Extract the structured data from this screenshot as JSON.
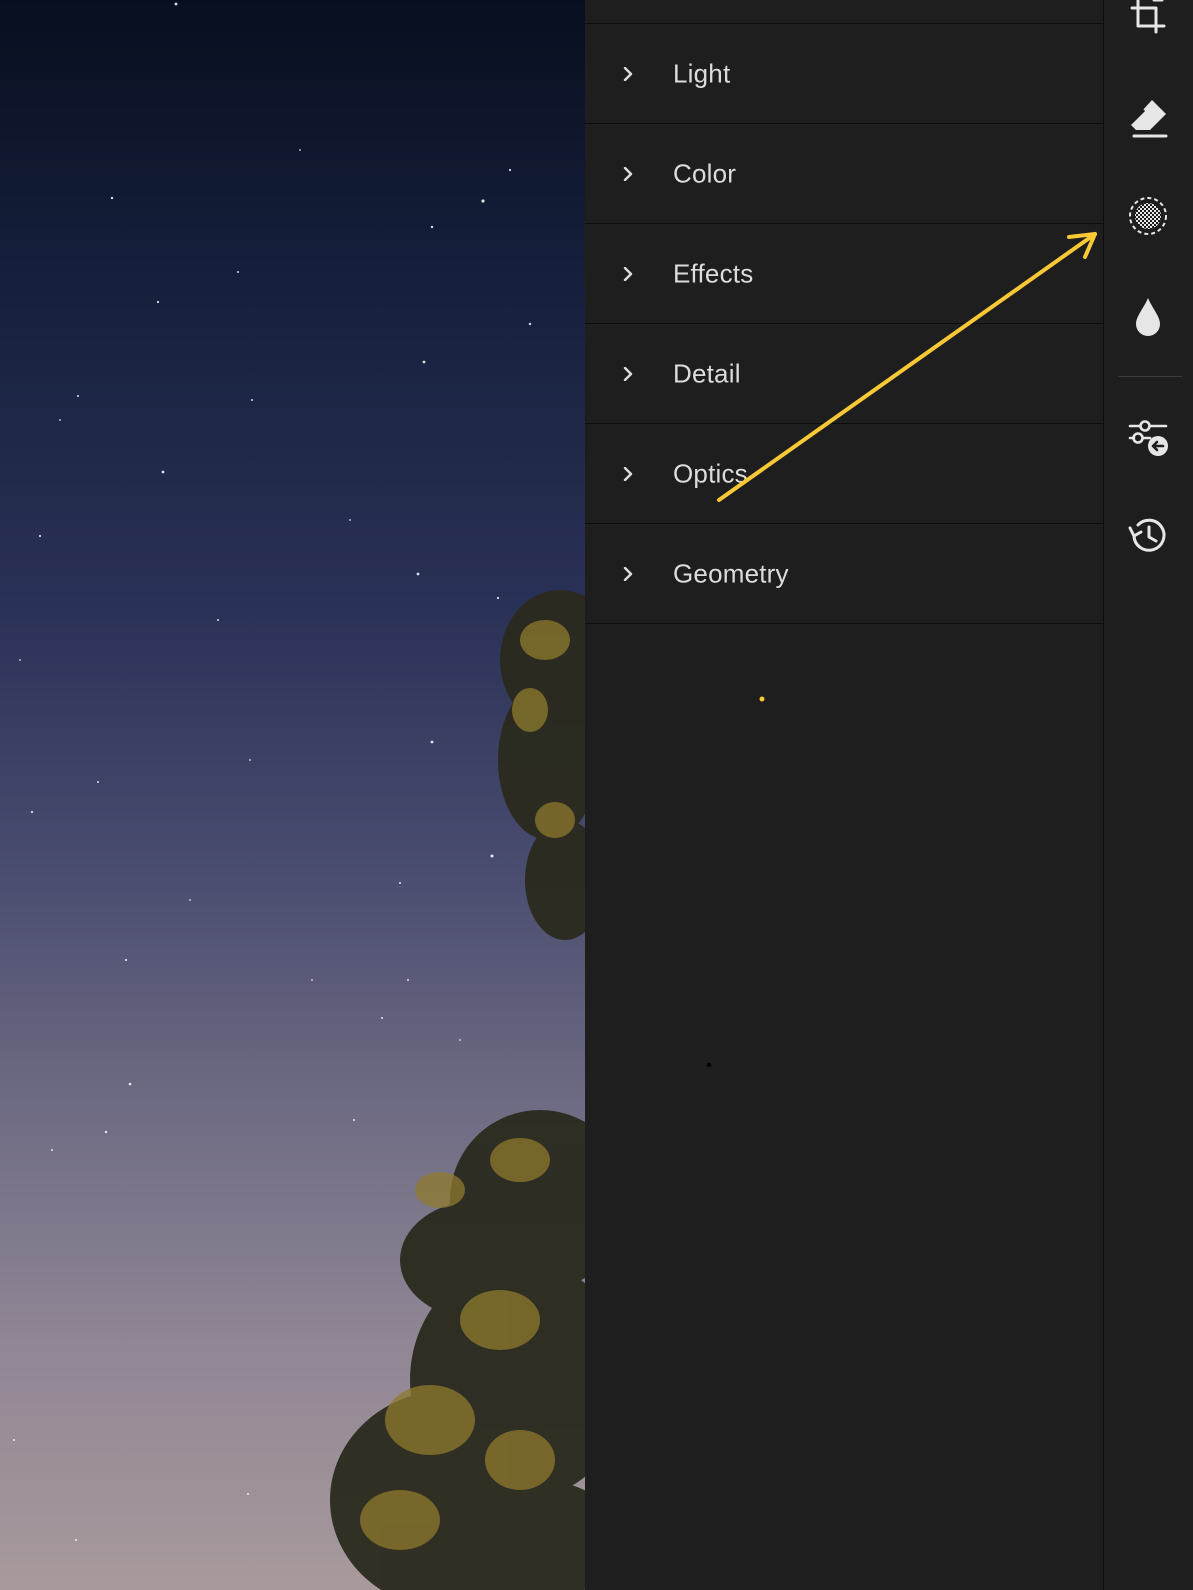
{
  "panel": {
    "sections": [
      {
        "label": "Light"
      },
      {
        "label": "Color"
      },
      {
        "label": "Effects"
      },
      {
        "label": "Detail"
      },
      {
        "label": "Optics"
      },
      {
        "label": "Geometry"
      }
    ]
  },
  "toolbar": {
    "tools": [
      "crop-icon",
      "eraser-icon",
      "masking-icon",
      "drop-icon",
      "presets-icon",
      "history-icon"
    ]
  },
  "colors": {
    "annotation_arrow": "#f8c935",
    "panel_bg": "#1e1e1e",
    "text": "#dcdcdc",
    "icon": "#e6e6e6"
  }
}
